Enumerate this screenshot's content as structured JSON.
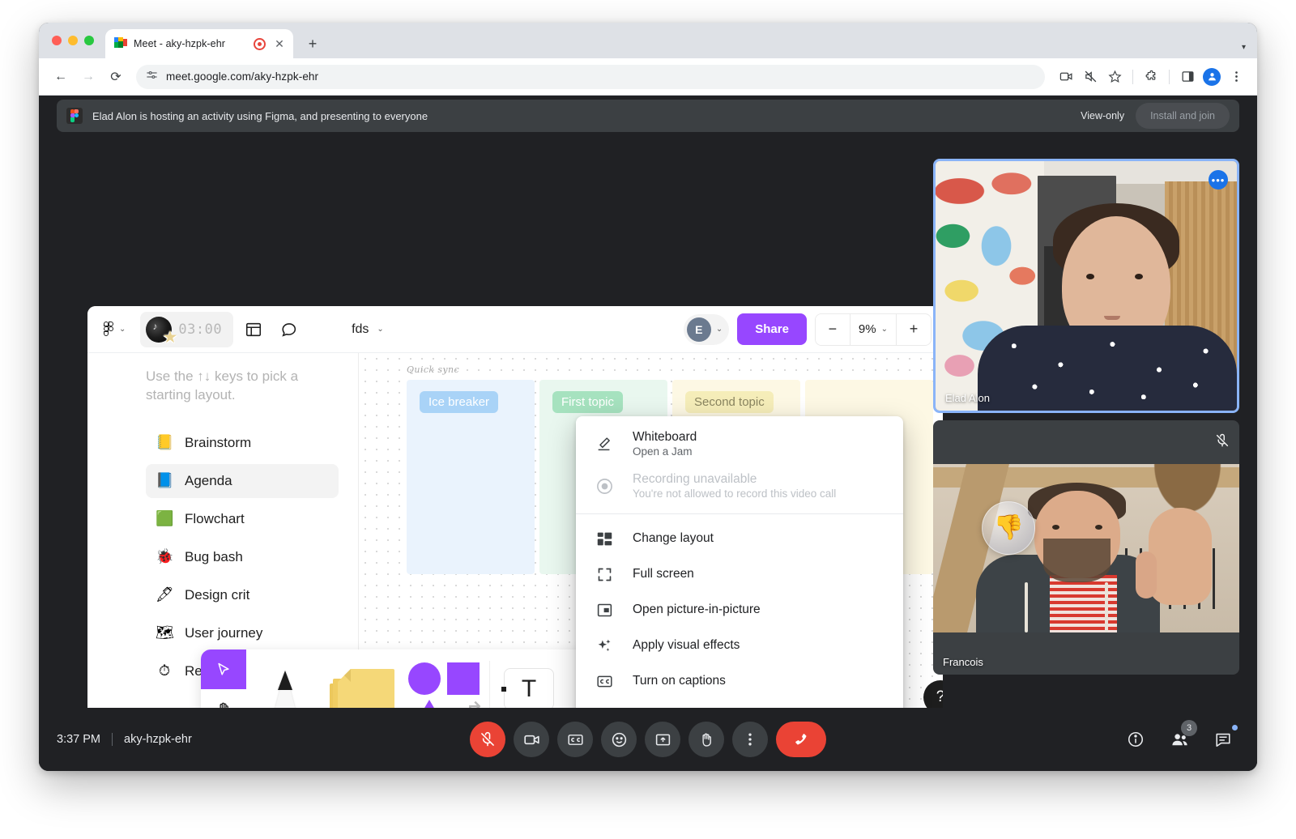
{
  "browser": {
    "tab": {
      "title": "Meet - aky-hzpk-ehr",
      "favicon": "google-meet-icon",
      "recording_indicator": "recording-icon",
      "close": "✕"
    },
    "new_tab": "+",
    "nav": {
      "back": "←",
      "forward": "→",
      "reload": "⟳"
    },
    "omnibox": {
      "url": "meet.google.com/aky-hzpk-ehr",
      "site_settings_icon": "tune-icon"
    },
    "toolbar_icons": [
      "camera-icon",
      "muted-speaker-icon",
      "bookmark-star-icon",
      "extensions-puzzle-icon",
      "side-panel-icon",
      "profile-avatar-icon",
      "browser-menu-icon"
    ]
  },
  "banner": {
    "app_icon": "figma-icon",
    "text": "Elad Alon is hosting an activity using Figma, and presenting to everyone",
    "view_only": "View-only",
    "install_and_join": "Install and join"
  },
  "figma": {
    "toolbar": {
      "logo": "figma-logo",
      "menu_chevron": "⌄",
      "timer": "03:00",
      "timer_widget_icon": "music-disc-star-icon",
      "layout_icon": "layout-grid-icon",
      "comment_icon": "comment-bubble-icon",
      "file_name": "fds",
      "file_chevron": "⌄",
      "avatar_initial": "E",
      "avatar_chevron": "⌄",
      "share_label": "Share",
      "zoom_out": "−",
      "zoom_value": "9%",
      "zoom_chevron": "⌄",
      "zoom_in": "+"
    },
    "sidebar": {
      "hint": "Use the ↑↓ keys to pick a starting layout.",
      "items": [
        {
          "icon": "📒",
          "label": "Brainstorm",
          "active": false
        },
        {
          "icon": "📘",
          "label": "Agenda",
          "active": true
        },
        {
          "icon": "🟩",
          "label": "Flowchart",
          "active": false
        },
        {
          "icon": "🐞",
          "label": "Bug bash",
          "active": false
        },
        {
          "icon": "🖋",
          "label": "Design crit",
          "active": false
        },
        {
          "icon": "🗺",
          "label": "User journey",
          "active": false
        },
        {
          "icon": "⏱",
          "label": "Retro",
          "active": false
        }
      ]
    },
    "board": {
      "title": "Quick sync",
      "columns": [
        {
          "label": "Ice breaker",
          "color": "blue"
        },
        {
          "label": "First topic",
          "color": "green"
        },
        {
          "label": "Second topic",
          "color": "yellow"
        },
        {
          "label": "",
          "color": "yellow"
        }
      ]
    },
    "tools": {
      "cursor_icon": "cursor-arrow-icon",
      "hand_icon": "hand-pan-icon",
      "pen_icon": "pen-marker-icon",
      "sticky_icon": "sticky-notes-icon",
      "shapes_icon": "shapes-icon",
      "text_icon": "T",
      "more_icon": "⋯"
    },
    "help_label": "?"
  },
  "context_menu": {
    "items": [
      {
        "icon": "pencil-icon",
        "title": "Whiteboard",
        "subtitle": "Open a Jam",
        "disabled": false
      },
      {
        "icon": "record-icon",
        "title": "Recording unavailable",
        "subtitle": "You're not allowed to record this video call",
        "disabled": true
      },
      {
        "icon": "layout-icon",
        "title": "Change layout",
        "subtitle": "",
        "disabled": false
      },
      {
        "icon": "fullscreen-icon",
        "title": "Full screen",
        "subtitle": "",
        "disabled": false
      },
      {
        "icon": "picture-in-picture-icon",
        "title": "Open picture-in-picture",
        "subtitle": "",
        "disabled": false
      },
      {
        "icon": "sparkles-icon",
        "title": "Apply visual effects",
        "subtitle": "",
        "disabled": false
      },
      {
        "icon": "captions-icon",
        "title": "Turn on captions",
        "subtitle": "",
        "disabled": false
      }
    ]
  },
  "participants": [
    {
      "name": "Elad Alon",
      "speaking": true,
      "muted": false,
      "reaction": "",
      "more_icon": "•••"
    },
    {
      "name": "Francois",
      "speaking": false,
      "muted": true,
      "reaction": "👎",
      "more_icon": ""
    }
  ],
  "meet_bar": {
    "time": "3:37 PM",
    "meeting_code": "aky-hzpk-ehr",
    "controls": [
      {
        "name": "microphone-muted-button",
        "icon": "mic-off-icon",
        "state": "danger"
      },
      {
        "name": "camera-button",
        "icon": "camera-icon",
        "state": "normal"
      },
      {
        "name": "captions-button",
        "icon": "cc-icon",
        "state": "normal"
      },
      {
        "name": "reactions-button",
        "icon": "emoji-smile-icon",
        "state": "normal"
      },
      {
        "name": "present-button",
        "icon": "present-screen-icon",
        "state": "normal"
      },
      {
        "name": "raise-hand-button",
        "icon": "raised-hand-icon",
        "state": "normal"
      },
      {
        "name": "more-options-button",
        "icon": "more-vertical-icon",
        "state": "normal"
      },
      {
        "name": "leave-call-button",
        "icon": "end-call-icon",
        "state": "end"
      }
    ],
    "right": {
      "info_icon": "info-circle-icon",
      "people_icon": "people-icon",
      "people_count": "3",
      "chat_icon": "chat-bubble-icon"
    }
  },
  "colors": {
    "accent_purple": "#9747ff",
    "meet_dark": "#202124",
    "meet_surface": "#3c4043",
    "danger_red": "#ea4335",
    "speaking_blue": "#8ab4f8"
  }
}
